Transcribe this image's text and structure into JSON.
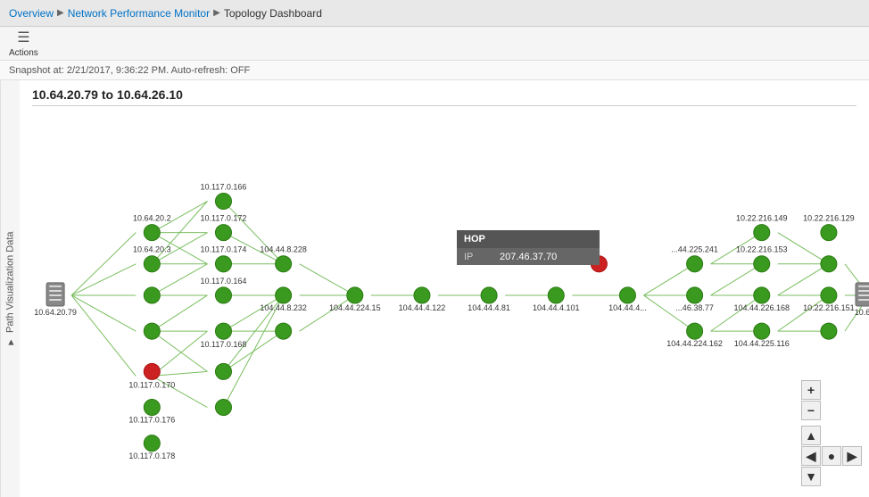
{
  "breadcrumb": {
    "overview": "Overview",
    "npm": "Network Performance Monitor",
    "current": "Topology Dashboard",
    "sep": "▶"
  },
  "toolbar": {
    "actions_label": "Actions",
    "actions_icon": "⚙"
  },
  "snapshot": {
    "text": "Snapshot at: 2/21/2017, 9:36:22 PM. Auto-refresh: OFF"
  },
  "left_panel": {
    "label": "Path Visualization Data",
    "chevron": "▶"
  },
  "path": {
    "title": "10.64.20.79 to 10.64.26.10"
  },
  "popup": {
    "header": "HOP",
    "ip_label": "IP",
    "ip_value": "207.46.37.70"
  },
  "zoom": {
    "plus": "+",
    "minus": "−",
    "up": "▲",
    "down": "▼",
    "left": "◀",
    "right": "▶",
    "mid": "●"
  }
}
